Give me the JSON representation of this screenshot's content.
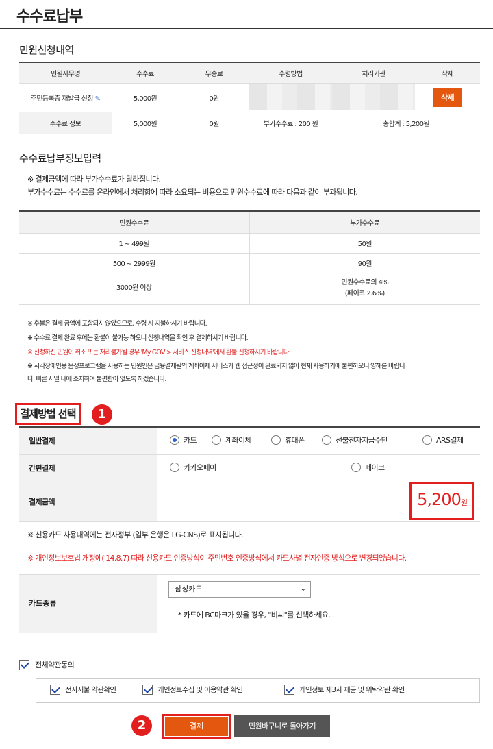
{
  "page": {
    "title": "수수료납부"
  },
  "application": {
    "heading": "민원신청내역",
    "headers": [
      "민원사무명",
      "수수료",
      "우송료",
      "수령방법",
      "처리기관",
      "삭제"
    ],
    "row": {
      "name": "주민등록증 재발급 신청",
      "fee": "5,000원",
      "postage": "0원",
      "delete_label": "삭제"
    },
    "info_row": {
      "label": "수수료 정보",
      "fee": "5,000원",
      "postage": "0원",
      "extra": "부가수수료 : 200 원",
      "total": "총합계 : 5,200원"
    }
  },
  "payment_info": {
    "heading": "수수료납부정보입력",
    "notice_line1": "※ 결제금액에 따라 부가수수료가 달라집니다.",
    "notice_line2": "부가수수료는 수수료를 온라인에서 처리함에 따라 소요되는 비용으로 민원수수료에 따라 다음과 같이 부과됩니다.",
    "headers": [
      "민원수수료",
      "부가수수료"
    ],
    "rows": [
      [
        "1 ~ 499원",
        "50원"
      ],
      [
        "500 ~ 2999원",
        "90원"
      ],
      [
        "3000원 이상",
        "민원수수료의 4%",
        "(페이코 2.6%)"
      ]
    ]
  },
  "notes": [
    "※ 후불은 결제 금액에 포함되지 않았으므로, 수령 시 지불하시기 바랍니다.",
    "※ 수수료 결제 완료 후에는 환불이 불가능 하오니 신청내역을 확인 후 결제하시기 바랍니다.",
    "※ 신청하신 민원이 취소 또는 처리불가될 경우 'My GOV > 서비스 신청내역'에서 환불 신청하시기 바랍니다.",
    "※ 시각장애인용 음성프로그램을 사용하는 민원인은 금융결제원의 계좌이체 서비스가 웹 접근성이 완료되지 않아 현재 사용하기에 불편하오니 양해를 바랍니",
    "다. 빠른 시일 내에 조치하여 불편함이 없도록 하겠습니다."
  ],
  "payment_method": {
    "heading": "결제방법 선택",
    "badge1": "1",
    "general_label": "일반결제",
    "general_options": [
      "카드",
      "계좌이체",
      "휴대폰",
      "선불전자지급수단",
      "ARS결제"
    ],
    "selected": "카드",
    "easy_label": "간편결제",
    "easy_options": [
      "카카오페이",
      "페이코"
    ],
    "amount_label": "결제금액",
    "amount": "5,200",
    "amount_unit": "원"
  },
  "card": {
    "notice": "※ 신용카드 사용내역에는 전자정부 (일부 은행은 LG-CNS)로 표시됩니다.",
    "notice_red": "※ 개인정보보호법 개정에('14.8.7) 따라 신용카드 인증방식이 주민번호 인증방식에서 카드사별 전자인증 방식으로 변경되었습니다.",
    "type_label": "카드종류",
    "selected_card": "삼성카드",
    "hint": "* 카드에 BC마크가 있을 경우, \"비씨\"를 선택하세요."
  },
  "agreements": {
    "all_label": "전체약관동의",
    "items": [
      "전자지불 약관확인",
      "개인정보수집 및 이용약관 확인",
      "개인정보 제3자 제공 및 위탁약관 확인"
    ]
  },
  "actions": {
    "badge2": "2",
    "pay_label": "결제",
    "back_label": "민원바구니로 돌아가기"
  },
  "colors": {
    "accent": "#e4570f",
    "highlight": "#e21e1e",
    "notice_red": "#e02020"
  }
}
